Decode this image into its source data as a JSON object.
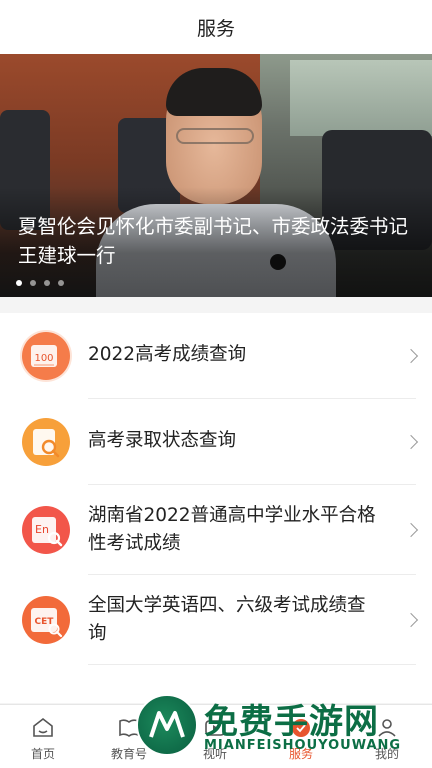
{
  "header": {
    "title": "服务"
  },
  "banner": {
    "caption": "夏智伦会见怀化市委副书记、市委政法委书记王建球一行",
    "dots": 4,
    "active_dot": 0
  },
  "services": [
    {
      "label": "2022高考成绩查询",
      "icon": "score-100-icon",
      "icon_text": "100",
      "color": "#f57c4a"
    },
    {
      "label": "高考录取状态查询",
      "icon": "search-doc-icon",
      "icon_text": "",
      "color": "#f7a03a"
    },
    {
      "label": "湖南省2022普通高中学业水平合格性考试成绩",
      "icon": "en-search-icon",
      "icon_text": "En",
      "color": "#f2564a"
    },
    {
      "label": "全国大学英语四、六级考试成绩查询",
      "icon": "cet-icon",
      "icon_text": "CET",
      "color": "#f26a3a"
    }
  ],
  "tabbar": {
    "items": [
      {
        "label": "首页",
        "icon": "home-icon"
      },
      {
        "label": "教育号",
        "icon": "book-icon"
      },
      {
        "label": "视听",
        "icon": "video-icon"
      },
      {
        "label": "服务",
        "icon": "service-icon"
      },
      {
        "label": "我的",
        "icon": "profile-icon"
      }
    ],
    "active": 3
  },
  "watermark": {
    "title": "免费手游网",
    "subtitle": "MIANFEISHOUYOUWANG"
  },
  "colors": {
    "accent": "#e8552e",
    "watermark": "#0c6e45"
  }
}
